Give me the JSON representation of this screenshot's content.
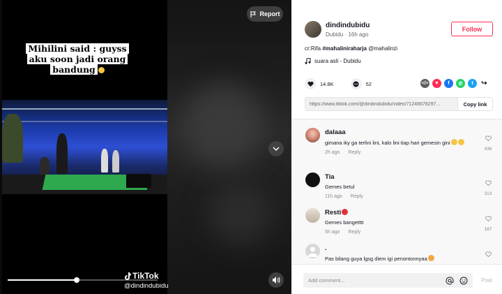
{
  "video": {
    "caption": "Mihilini said : guyss aku soon jadi orang bandung",
    "report_label": "Report",
    "watermark_brand": "TikTok",
    "watermark_handle": "@dindindubidu",
    "progress": 0.46
  },
  "author": {
    "username": "dindindubidu",
    "display_name": "Dubidu",
    "time": "16h ago",
    "follow_label": "Follow"
  },
  "post": {
    "description_prefix": "cr:Rifa ",
    "hashtag": "#mahaliniraharja",
    "mention": " @mahalinzi",
    "music": "suara asli - Dubidu",
    "likes": "14.8K",
    "comments": "52",
    "link": "https://www.tiktok.com/@dindindubidu/video/71246678297...",
    "copy_label": "Copy link"
  },
  "share_icons": [
    {
      "name": "embed-icon",
      "color": "#5d5d5d"
    },
    {
      "name": "friends-icon",
      "color": "#fe2c55"
    },
    {
      "name": "facebook-icon",
      "color": "#1877f2"
    },
    {
      "name": "whatsapp-icon",
      "color": "#25d366"
    },
    {
      "name": "twitter-icon",
      "color": "#1da1f2"
    },
    {
      "name": "share-icon",
      "color": "#161823"
    }
  ],
  "comments": [
    {
      "user": "dalaaa",
      "text": "gimana iky ga terlini lini, kalo lini tiap hari gemesin gini",
      "time": "2h ago",
      "reply": "Reply",
      "likes": "436"
    },
    {
      "user": "Tia",
      "text": "Gemes betul",
      "time": "11h ago",
      "reply": "Reply",
      "likes": "313"
    },
    {
      "user": "Resti",
      "text": "Gemes bangetttt",
      "time": "5h ago",
      "reply": "Reply",
      "likes": "187"
    },
    {
      "user": ".",
      "text": "Pas bilang guya lgsg diem igi penontonnyaa",
      "time": "",
      "reply": "",
      "likes": ""
    }
  ],
  "add_comment": {
    "placeholder": "Add comment...",
    "post_label": "Post"
  },
  "colors": {
    "accent": "#fe2c55"
  }
}
